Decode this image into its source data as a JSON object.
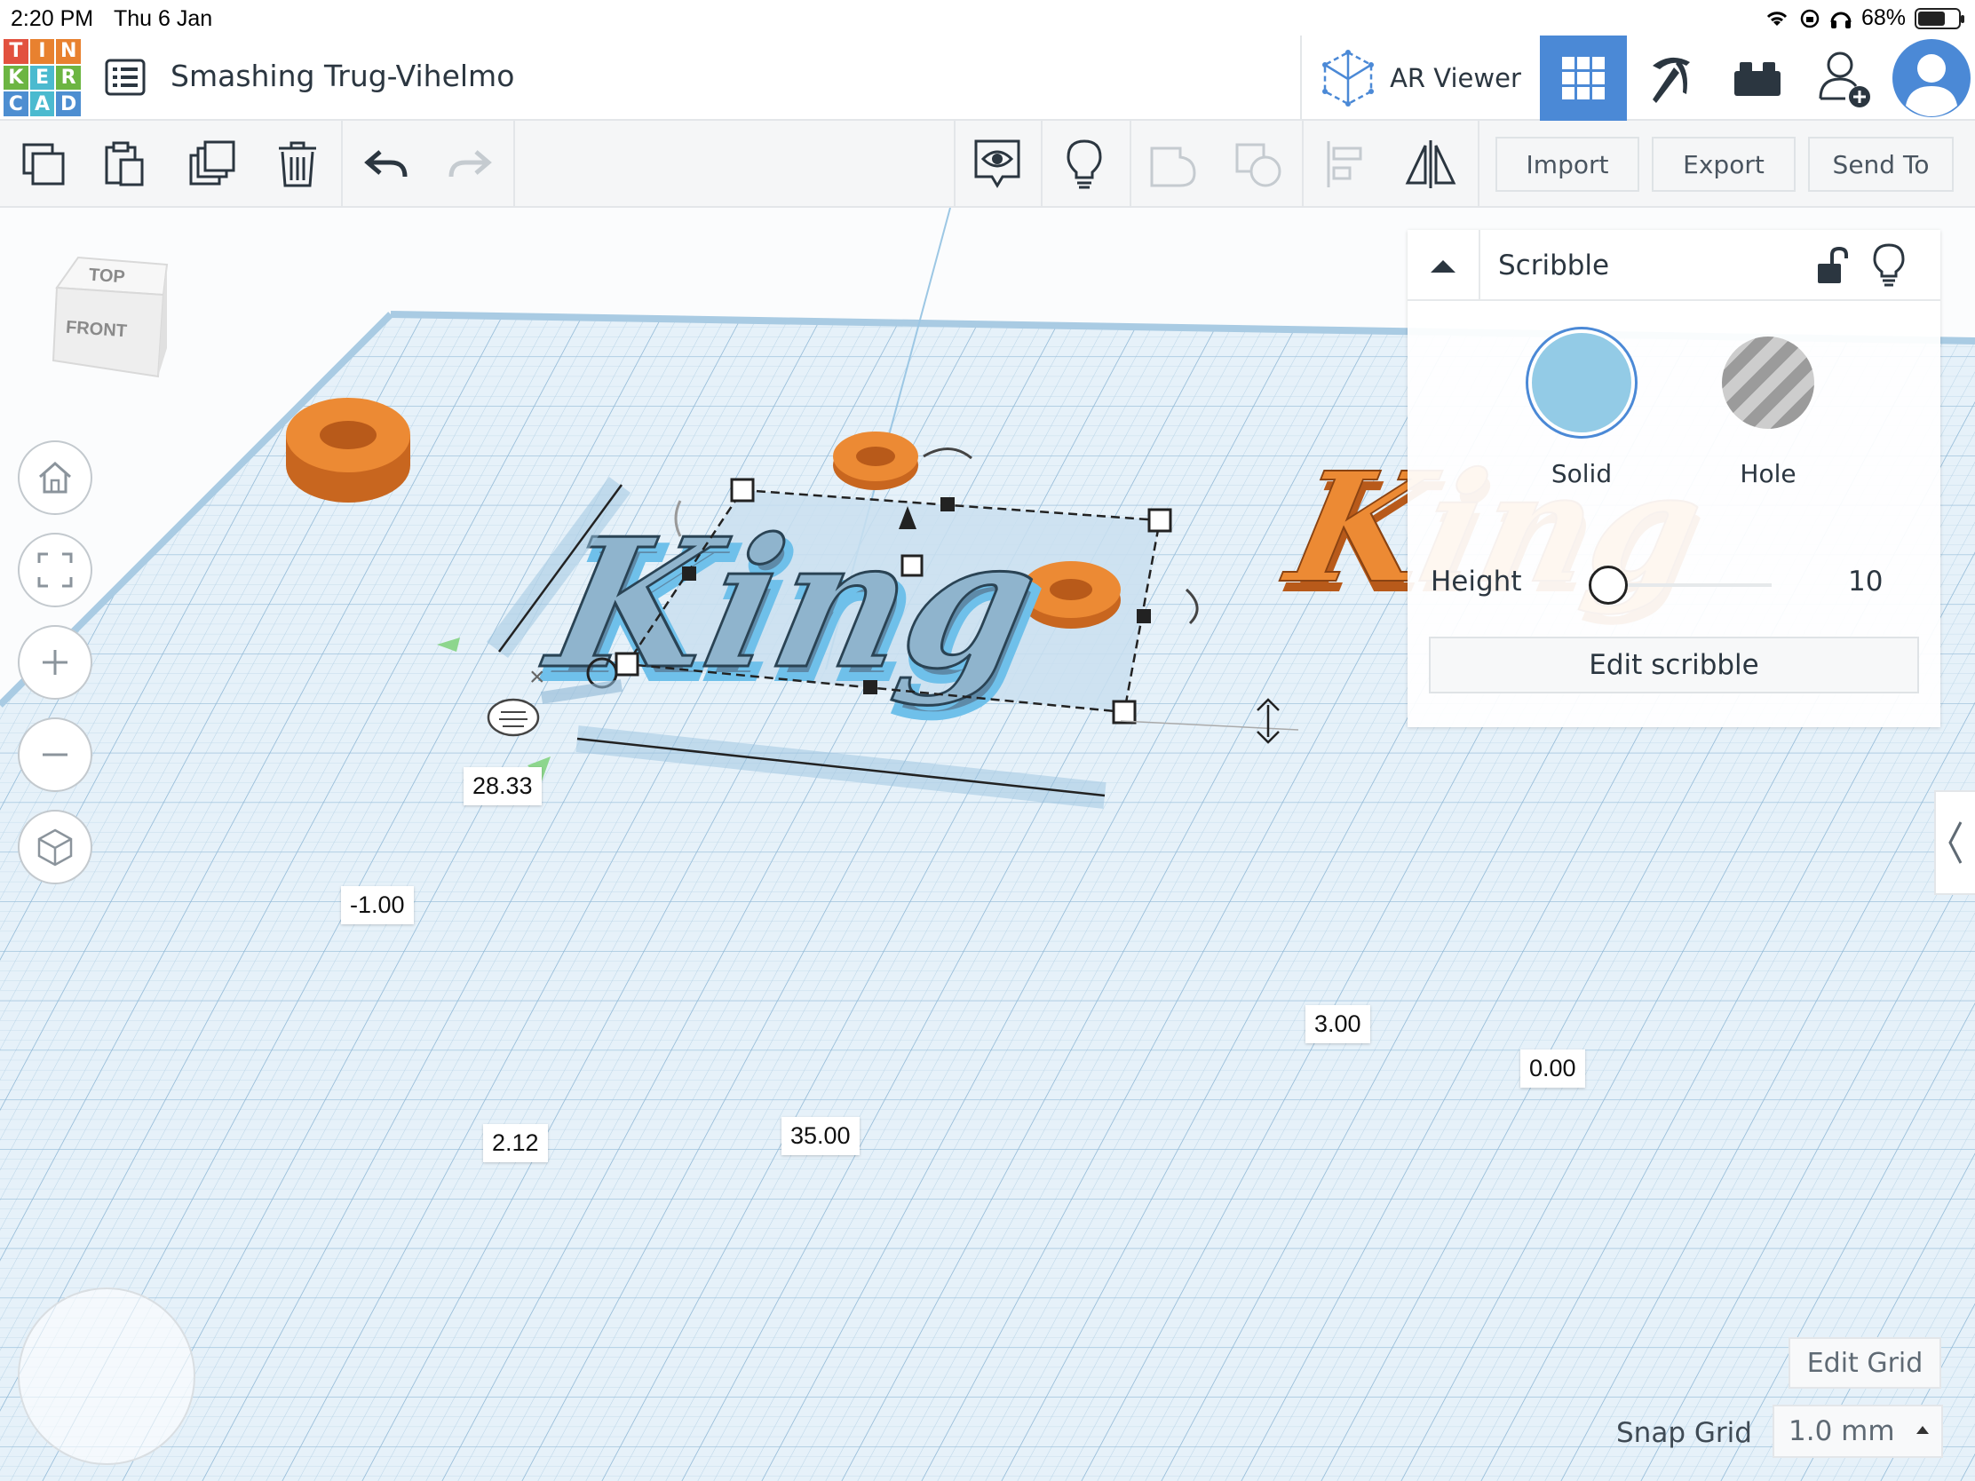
{
  "status_bar": {
    "time": "2:20 PM",
    "date": "Thu 6 Jan",
    "battery": "68%",
    "battery_level": 0.68
  },
  "app": {
    "logo_letters": [
      "T",
      "I",
      "N",
      "K",
      "E",
      "R",
      "C",
      "A",
      "D"
    ],
    "logo_colors": [
      "#e2513f",
      "#e8812f",
      "#e8812f",
      "#6cb542",
      "#4bbacf",
      "#6cb542",
      "#4d8ed1",
      "#4bbacf",
      "#4d8ed1"
    ],
    "design_title": "Smashing Trug-Vihelmo",
    "ar_viewer_label": "AR Viewer",
    "accent_color": "#4b89d6"
  },
  "toolbar": {
    "import_label": "Import",
    "export_label": "Export",
    "send_to_label": "Send To"
  },
  "viewcube": {
    "top_label": "TOP",
    "front_label": "FRONT"
  },
  "dimensions": {
    "depth": "28.33",
    "elevation": "-1.00",
    "height": "3.00",
    "offset_right": "0.00",
    "offset_left": "2.12",
    "width": "35.00"
  },
  "inspector": {
    "title": "Scribble",
    "solid_label": "Solid",
    "hole_label": "Hole",
    "solid_color": "#93cbe6",
    "height_label": "Height",
    "height_value": "10",
    "height_level": 0.1,
    "edit_button": "Edit scribble"
  },
  "grid_controls": {
    "edit_grid_label": "Edit Grid",
    "snap_grid_label": "Snap Grid",
    "snap_value": "1.0 mm"
  },
  "scene": {
    "shape_text": "King",
    "shape_color": "#e9842f",
    "selected_color": "#8fb4cd"
  }
}
